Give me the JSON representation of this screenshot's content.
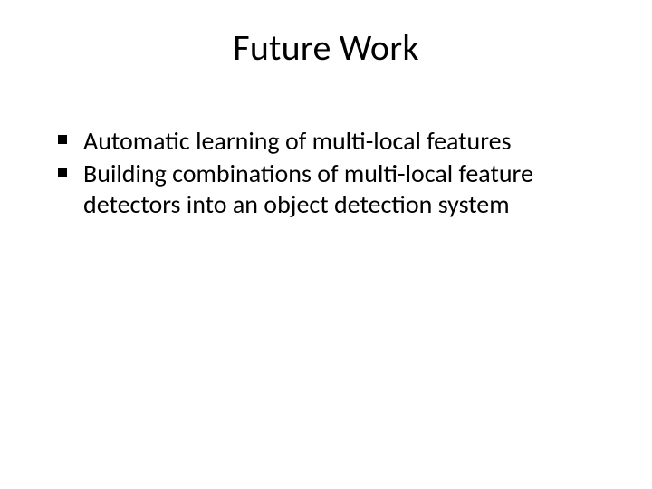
{
  "slide": {
    "title": "Future Work",
    "bullets": [
      "Automatic learning of multi-local features",
      "Building combinations of multi-local feature detectors into an object detection system"
    ]
  }
}
